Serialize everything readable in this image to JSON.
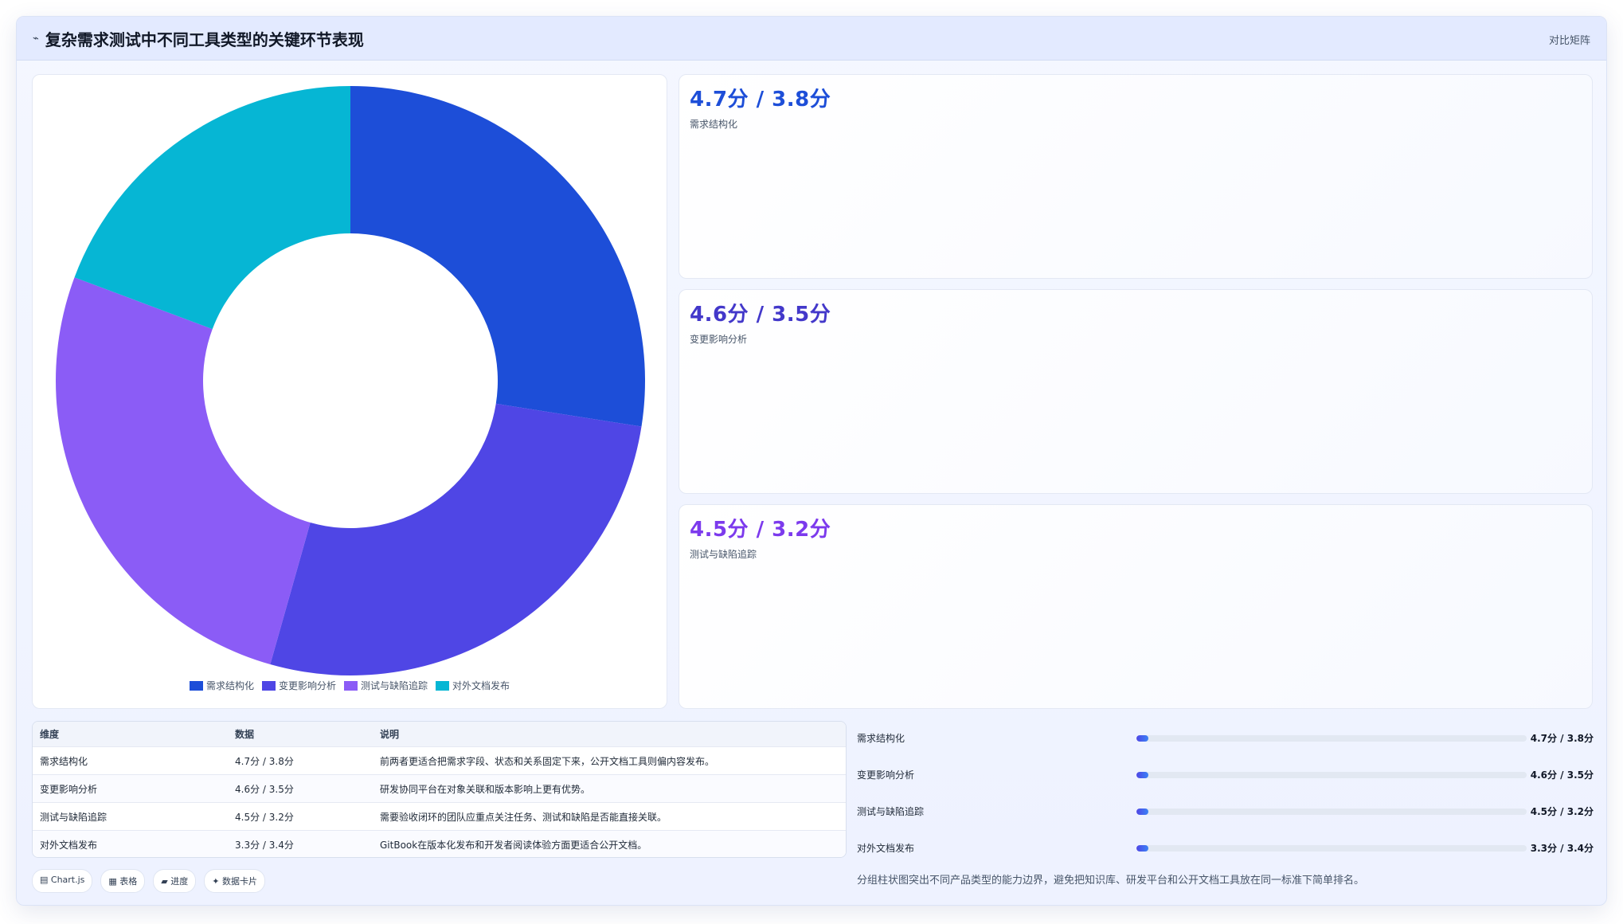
{
  "header": {
    "icon": "chart-icon",
    "title": "复杂需求测试中不同工具类型的关键环节表现",
    "right_label": "对比矩阵"
  },
  "chart_data": {
    "type": "pie",
    "categories": [
      "需求结构化",
      "变更影响分析",
      "测试与缺陷追踪",
      "对外文档发布"
    ],
    "values": [
      4.7,
      4.6,
      4.5,
      3.3
    ],
    "colors": [
      "#1d4ed8",
      "#4f46e5",
      "#8b5cf6",
      "#06b6d4"
    ],
    "legend_position": "bottom"
  },
  "stats": [
    {
      "value": "4.7分 / 3.8分",
      "label": "需求结构化",
      "color": "#1d4ed8"
    },
    {
      "value": "4.6分 / 3.5分",
      "label": "变更影响分析",
      "color": "#4338ca"
    },
    {
      "value": "4.5分 / 3.2分",
      "label": "测试与缺陷追踪",
      "color": "#7c3aed"
    }
  ],
  "table": {
    "headers": [
      "维度",
      "数据",
      "说明"
    ],
    "rows": [
      [
        "需求结构化",
        "4.7分 / 3.8分",
        "前两者更适合把需求字段、状态和关系固定下来，公开文档工具则偏内容发布。"
      ],
      [
        "变更影响分析",
        "4.6分 / 3.5分",
        "研发协同平台在对象关联和版本影响上更有优势。"
      ],
      [
        "测试与缺陷追踪",
        "4.5分 / 3.2分",
        "需要验收闭环的团队应重点关注任务、测试和缺陷是否能直接关联。"
      ],
      [
        "对外文档发布",
        "3.3分 / 3.4分",
        "GitBook在版本化发布和开发者阅读体验方面更适合公开文档。"
      ]
    ]
  },
  "progress": [
    {
      "label": "需求结构化",
      "value": "4.7分 / 3.8分",
      "fill_percent": 3
    },
    {
      "label": "变更影响分析",
      "value": "4.6分 / 3.5分",
      "fill_percent": 3
    },
    {
      "label": "测试与缺陷追踪",
      "value": "4.5分 / 3.2分",
      "fill_percent": 3
    },
    {
      "label": "对外文档发布",
      "value": "3.3分 / 3.4分",
      "fill_percent": 3
    }
  ],
  "chips": [
    "▤ Chart.js",
    "▦ 表格",
    "▰ 进度",
    "✦ 数据卡片"
  ],
  "footnote": "分组柱状图突出不同产品类型的能力边界，避免把知识库、研发平台和公开文档工具放在同一标准下简单排名。"
}
